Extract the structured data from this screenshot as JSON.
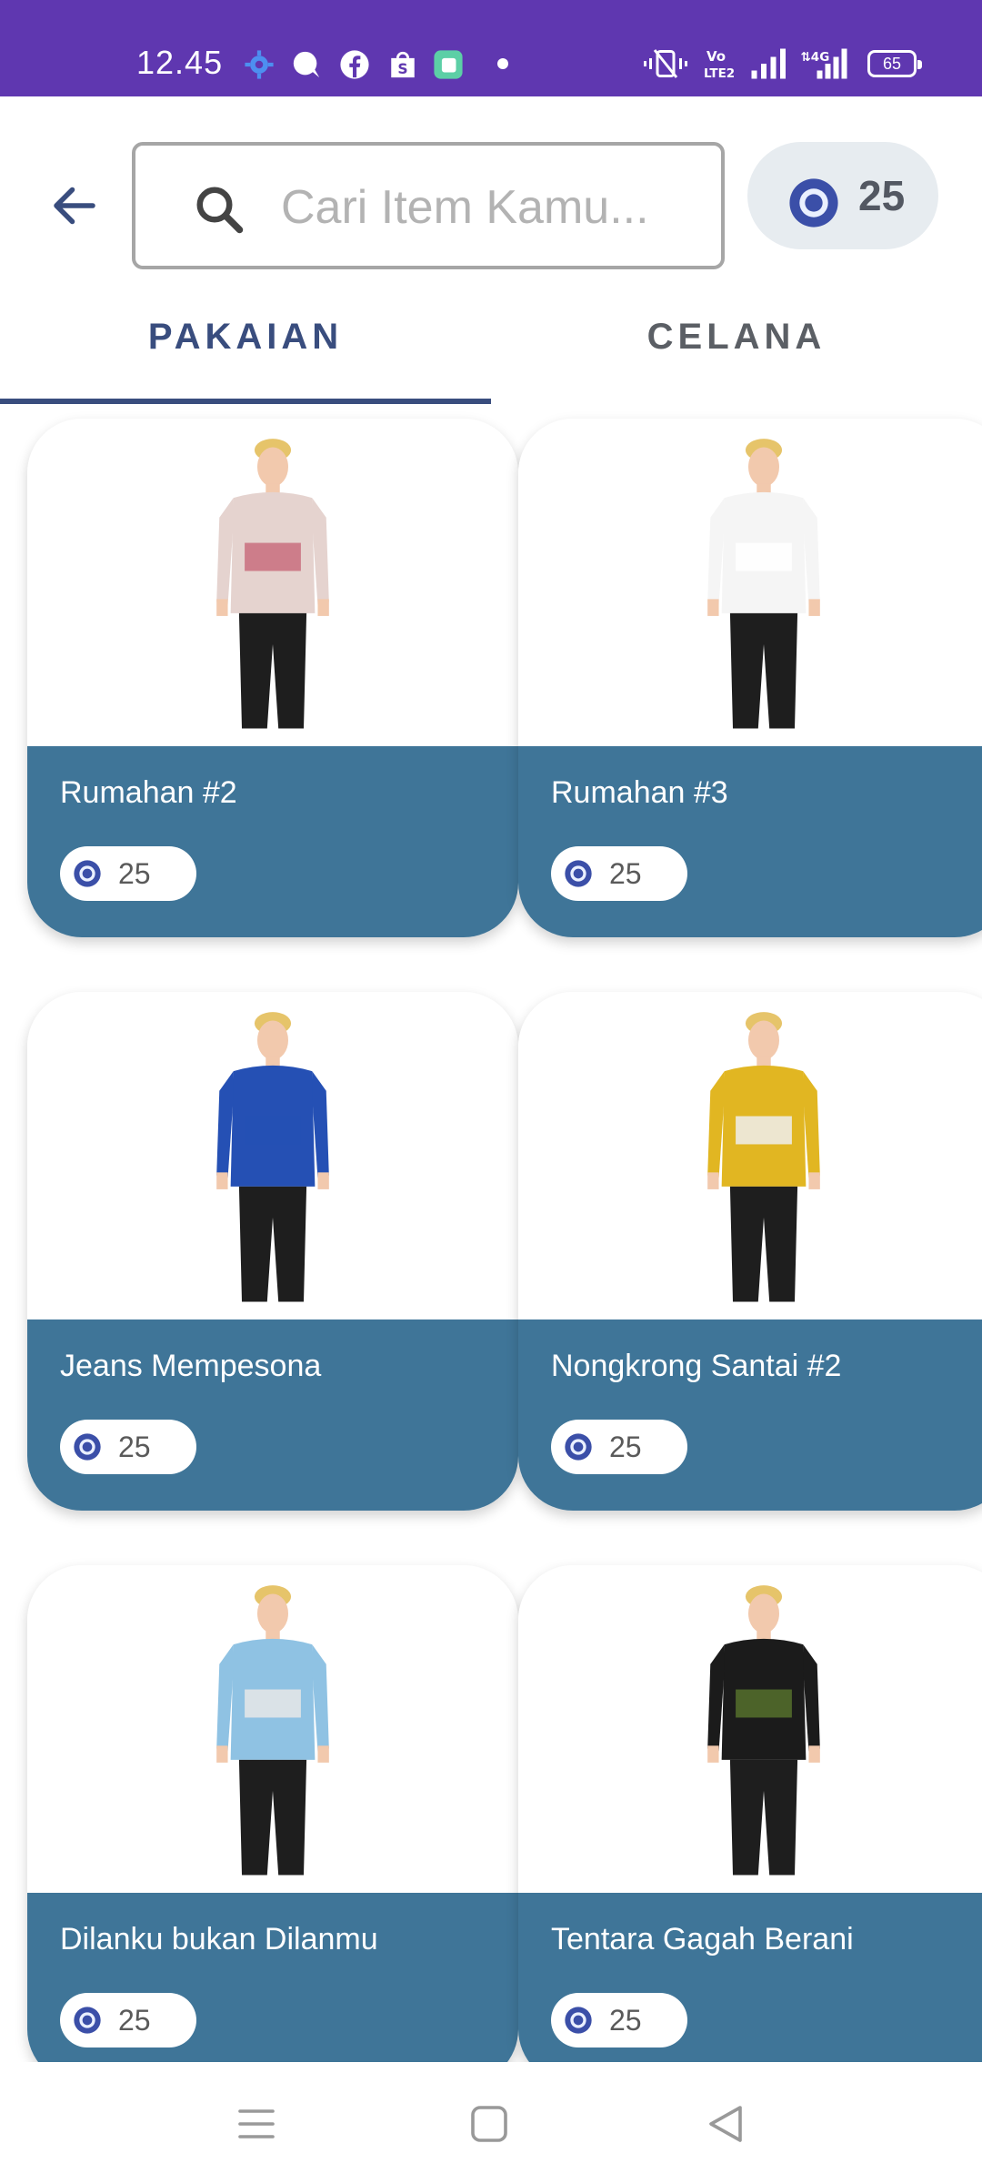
{
  "status_bar": {
    "time": "12.45",
    "battery": "65",
    "notification_icons": [
      "gear-icon",
      "chat-icon",
      "facebook-icon",
      "shop-icon",
      "app-icon",
      "dot-icon"
    ],
    "system_icons": [
      "vibrate-icon",
      "volte-icon",
      "signal-icon",
      "4g-signal-icon",
      "battery-icon"
    ],
    "bar_color": "#5f37b0"
  },
  "header": {
    "back_icon": "arrow-left-icon",
    "search": {
      "placeholder": "Cari Item Kamu...",
      "value": ""
    },
    "coins": "25"
  },
  "tabs": [
    {
      "label": "PAKAIAN",
      "active": true
    },
    {
      "label": "CELANA",
      "active": false
    }
  ],
  "items": [
    {
      "name": "Rumahan #2",
      "price": "25",
      "shirt": "#e5d3cf",
      "stripe": "#c96d7e"
    },
    {
      "name": "Rumahan #3",
      "price": "25",
      "shirt": "#f5f5f5",
      "stripe": "#ffffff"
    },
    {
      "name": "Jeans Mempesona",
      "price": "25",
      "shirt": "#2550b4",
      "stripe": "#2550b4"
    },
    {
      "name": "Nongkrong Santai #2",
      "price": "25",
      "shirt": "#e1b622",
      "stripe": "#eeeeee"
    },
    {
      "name": "Dilanku bukan Dilanmu",
      "price": "25",
      "shirt": "#8fc2e3",
      "stripe": "#e8e8e8"
    },
    {
      "name": "Tentara Gagah Berani",
      "price": "25",
      "shirt": "#1b1b1b",
      "stripe": "#55702b"
    }
  ],
  "colors": {
    "accent": "#394d7e",
    "card_info": "#3f7598",
    "coin_chip": "#e7ecf0"
  },
  "nav": [
    "menu-icon",
    "home-icon",
    "back-icon"
  ]
}
